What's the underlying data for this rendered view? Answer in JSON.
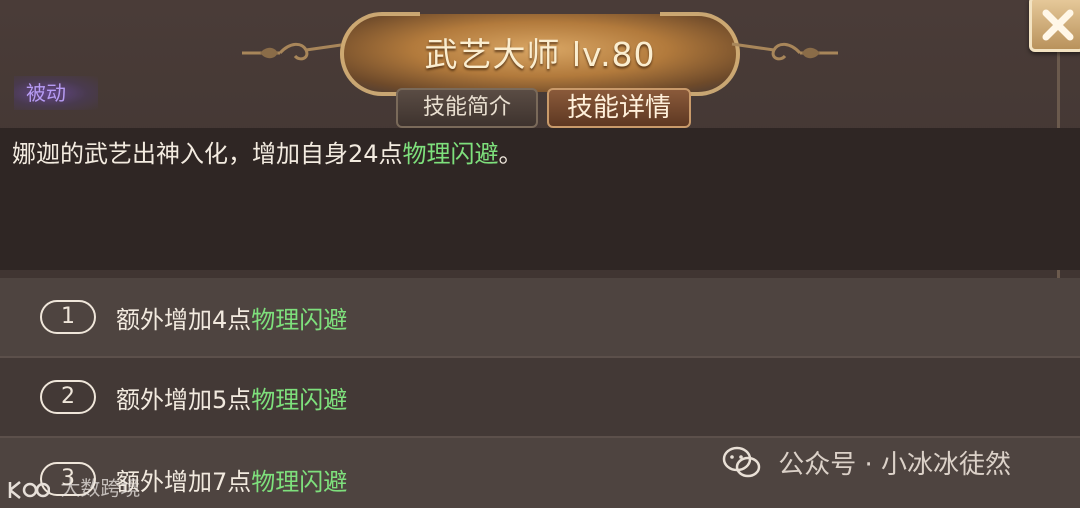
{
  "skill": {
    "title": "武艺大师 lv.80",
    "type_tag": "被动"
  },
  "tabs": [
    {
      "label": "技能简介",
      "active": false
    },
    {
      "label": "技能详情",
      "active": true
    }
  ],
  "description": {
    "prefix": "娜迦的武艺出神入化，增加自身24点",
    "highlight": "物理闪避",
    "suffix": "。"
  },
  "bonuses": [
    {
      "num": "1",
      "text": "额外增加4点",
      "highlight": "物理闪避"
    },
    {
      "num": "2",
      "text": "额外增加5点",
      "highlight": "物理闪避"
    },
    {
      "num": "3",
      "text": "额外增加7点",
      "highlight": "物理闪避"
    }
  ],
  "watermarks": {
    "right": "公众号 · 小冰冰徒然",
    "left": "大数跨境"
  },
  "icons": {
    "close": "close-x-icon",
    "wechat": "wechat-icon"
  },
  "colors": {
    "highlight": "#7ee07c",
    "passive": "#b79cf4",
    "title": "#fbeed0"
  }
}
